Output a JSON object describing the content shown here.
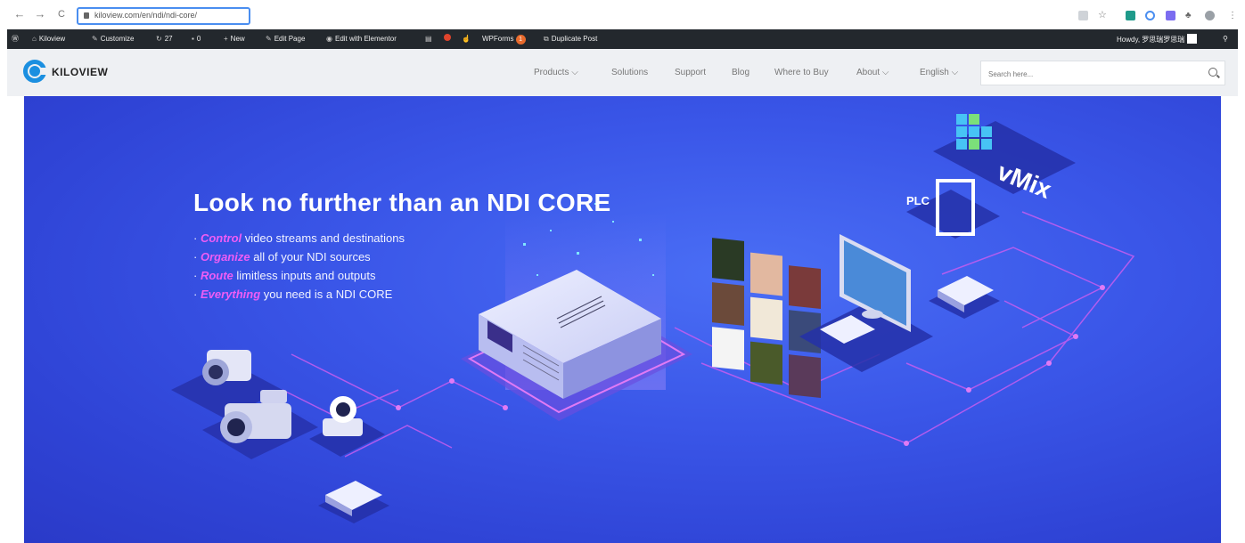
{
  "browser": {
    "url": "kiloview.com/en/ndi/ndi-core/",
    "back_icon": "←",
    "forward_icon": "→",
    "reload_icon": "C"
  },
  "admin_bar": {
    "site_name": "Kiloview",
    "customize": "Customize",
    "updates_count": "27",
    "comments_count": "0",
    "new": "New",
    "edit_page": "Edit Page",
    "edit_elementor": "Edit with Elementor",
    "wpforms": "WPForms",
    "wpforms_badge": "1",
    "duplicate_post": "Duplicate Post",
    "howdy": "Howdy, 罗思瑞罗思瑞"
  },
  "site_header": {
    "logo_text": "KILOVIEW",
    "nav": [
      "Products",
      "Solutions",
      "Support",
      "Blog",
      "Where to Buy",
      "About",
      "English"
    ],
    "search_placeholder": "Search here..."
  },
  "hero": {
    "title": "Look no further than an NDI CORE",
    "features": [
      {
        "keyword": "Control",
        "text": " video streams and destinations"
      },
      {
        "keyword": "Organize",
        "text": " all of your NDI sources"
      },
      {
        "keyword": "Route",
        "text": " limitless inputs and outputs"
      },
      {
        "keyword": "Everything",
        "text": " you need is a NDI CORE"
      }
    ],
    "vmix_label": "vMix",
    "plc_label": "PLC"
  },
  "colors": {
    "accent_blue": "#1b8fe0",
    "hero_blue": "#3a56e8",
    "feature_keyword": "#ee5df5",
    "admin_bar": "#23282d"
  }
}
